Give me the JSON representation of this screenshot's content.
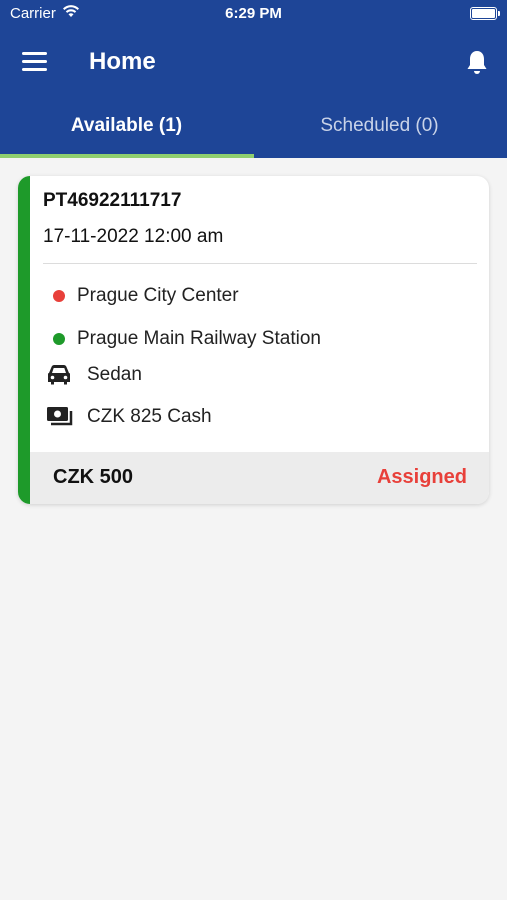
{
  "status_bar": {
    "carrier": "Carrier",
    "time": "6:29 PM"
  },
  "header": {
    "title": "Home"
  },
  "tabs": [
    {
      "label": "Available (1)",
      "active": true
    },
    {
      "label": "Scheduled (0)",
      "active": false
    }
  ],
  "rides": [
    {
      "id": "PT46922111717",
      "datetime": "17-11-2022 12:00 am",
      "pickup": "Prague City Center",
      "drop": "Prague Main Railway Station",
      "vehicle": "Sedan",
      "payment": "CZK 825 Cash",
      "fare": "CZK 500",
      "status": "Assigned"
    }
  ],
  "colors": {
    "header_bg": "#1e4597",
    "tab_indicator": "#8fcf6f",
    "card_accent": "#1e9a2a",
    "pickup_dot": "#e8403a",
    "drop_dot": "#1e9a2a",
    "status_assigned": "#e8403a"
  },
  "icons": {
    "menu": "hamburger-icon",
    "notifications": "bell-icon",
    "vehicle": "car-icon",
    "payment": "cash-icon"
  }
}
